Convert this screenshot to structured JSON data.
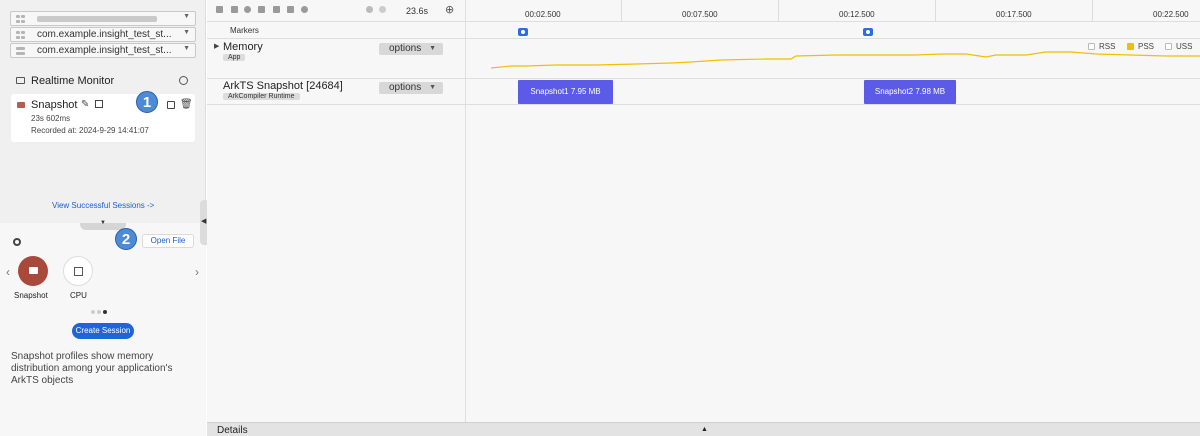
{
  "left": {
    "device_dropdown": {
      "value": ""
    },
    "app_dropdown_1": {
      "value": "com.example.insight_test_st..."
    },
    "app_dropdown_2": {
      "value": "com.example.insight_test_st..."
    },
    "realtime_monitor": "Realtime Monitor",
    "session": {
      "name": "Snapshot",
      "duration": "23s 602ms",
      "recorded_at": "Recorded at: 2024-9-29 14:41:07"
    },
    "badge_1": "1",
    "badge_2": "2",
    "view_sessions": "View Successful Sessions ->",
    "open_file": "Open File",
    "templates": [
      {
        "label": "Snapshot",
        "icon": "camera-icon"
      },
      {
        "label": "CPU",
        "icon": "chip-icon"
      }
    ],
    "create_session": "Create Session",
    "description": "Snapshot profiles show memory distribution among your application's ArkTS objects"
  },
  "toolbar": {
    "duration": "23.6s"
  },
  "ruler": {
    "ticks": [
      "00:02.500",
      "00:07.500",
      "00:12.500",
      "00:17.500",
      "00:22.500"
    ]
  },
  "tracks": {
    "markers": {
      "label": "Markers"
    },
    "memory": {
      "label": "Memory",
      "sub": "App",
      "options": "options",
      "legend": [
        {
          "name": "RSS",
          "color": "#ffffff"
        },
        {
          "name": "PSS",
          "color": "#f0c000"
        },
        {
          "name": "USS",
          "color": "#ffffff"
        }
      ]
    },
    "arkts": {
      "label": "ArkTS Snapshot [24684]",
      "sub": "ArkCompiler Runtime",
      "options": "options",
      "snapshots": [
        {
          "label": "Snapshot1 7.95 MB"
        },
        {
          "label": "Snapshot2 7.98 MB"
        }
      ]
    }
  },
  "details": {
    "label": "Details"
  },
  "colors": {
    "accent": "#1f65d8",
    "snapshot_block": "#5b5be8",
    "pss_line": "#f0c000",
    "badge": "#4f8ad6"
  }
}
